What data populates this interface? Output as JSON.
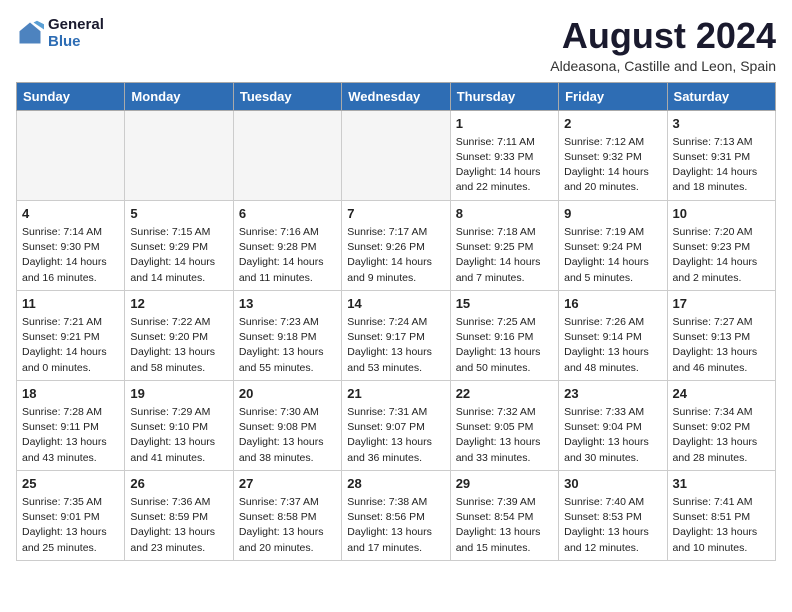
{
  "header": {
    "logo_line1": "General",
    "logo_line2": "Blue",
    "month_year": "August 2024",
    "location": "Aldeasona, Castille and Leon, Spain"
  },
  "days_of_week": [
    "Sunday",
    "Monday",
    "Tuesday",
    "Wednesday",
    "Thursday",
    "Friday",
    "Saturday"
  ],
  "weeks": [
    [
      {
        "day": "",
        "info": ""
      },
      {
        "day": "",
        "info": ""
      },
      {
        "day": "",
        "info": ""
      },
      {
        "day": "",
        "info": ""
      },
      {
        "day": "1",
        "info": "Sunrise: 7:11 AM\nSunset: 9:33 PM\nDaylight: 14 hours\nand 22 minutes."
      },
      {
        "day": "2",
        "info": "Sunrise: 7:12 AM\nSunset: 9:32 PM\nDaylight: 14 hours\nand 20 minutes."
      },
      {
        "day": "3",
        "info": "Sunrise: 7:13 AM\nSunset: 9:31 PM\nDaylight: 14 hours\nand 18 minutes."
      }
    ],
    [
      {
        "day": "4",
        "info": "Sunrise: 7:14 AM\nSunset: 9:30 PM\nDaylight: 14 hours\nand 16 minutes."
      },
      {
        "day": "5",
        "info": "Sunrise: 7:15 AM\nSunset: 9:29 PM\nDaylight: 14 hours\nand 14 minutes."
      },
      {
        "day": "6",
        "info": "Sunrise: 7:16 AM\nSunset: 9:28 PM\nDaylight: 14 hours\nand 11 minutes."
      },
      {
        "day": "7",
        "info": "Sunrise: 7:17 AM\nSunset: 9:26 PM\nDaylight: 14 hours\nand 9 minutes."
      },
      {
        "day": "8",
        "info": "Sunrise: 7:18 AM\nSunset: 9:25 PM\nDaylight: 14 hours\nand 7 minutes."
      },
      {
        "day": "9",
        "info": "Sunrise: 7:19 AM\nSunset: 9:24 PM\nDaylight: 14 hours\nand 5 minutes."
      },
      {
        "day": "10",
        "info": "Sunrise: 7:20 AM\nSunset: 9:23 PM\nDaylight: 14 hours\nand 2 minutes."
      }
    ],
    [
      {
        "day": "11",
        "info": "Sunrise: 7:21 AM\nSunset: 9:21 PM\nDaylight: 14 hours\nand 0 minutes."
      },
      {
        "day": "12",
        "info": "Sunrise: 7:22 AM\nSunset: 9:20 PM\nDaylight: 13 hours\nand 58 minutes."
      },
      {
        "day": "13",
        "info": "Sunrise: 7:23 AM\nSunset: 9:18 PM\nDaylight: 13 hours\nand 55 minutes."
      },
      {
        "day": "14",
        "info": "Sunrise: 7:24 AM\nSunset: 9:17 PM\nDaylight: 13 hours\nand 53 minutes."
      },
      {
        "day": "15",
        "info": "Sunrise: 7:25 AM\nSunset: 9:16 PM\nDaylight: 13 hours\nand 50 minutes."
      },
      {
        "day": "16",
        "info": "Sunrise: 7:26 AM\nSunset: 9:14 PM\nDaylight: 13 hours\nand 48 minutes."
      },
      {
        "day": "17",
        "info": "Sunrise: 7:27 AM\nSunset: 9:13 PM\nDaylight: 13 hours\nand 46 minutes."
      }
    ],
    [
      {
        "day": "18",
        "info": "Sunrise: 7:28 AM\nSunset: 9:11 PM\nDaylight: 13 hours\nand 43 minutes."
      },
      {
        "day": "19",
        "info": "Sunrise: 7:29 AM\nSunset: 9:10 PM\nDaylight: 13 hours\nand 41 minutes."
      },
      {
        "day": "20",
        "info": "Sunrise: 7:30 AM\nSunset: 9:08 PM\nDaylight: 13 hours\nand 38 minutes."
      },
      {
        "day": "21",
        "info": "Sunrise: 7:31 AM\nSunset: 9:07 PM\nDaylight: 13 hours\nand 36 minutes."
      },
      {
        "day": "22",
        "info": "Sunrise: 7:32 AM\nSunset: 9:05 PM\nDaylight: 13 hours\nand 33 minutes."
      },
      {
        "day": "23",
        "info": "Sunrise: 7:33 AM\nSunset: 9:04 PM\nDaylight: 13 hours\nand 30 minutes."
      },
      {
        "day": "24",
        "info": "Sunrise: 7:34 AM\nSunset: 9:02 PM\nDaylight: 13 hours\nand 28 minutes."
      }
    ],
    [
      {
        "day": "25",
        "info": "Sunrise: 7:35 AM\nSunset: 9:01 PM\nDaylight: 13 hours\nand 25 minutes."
      },
      {
        "day": "26",
        "info": "Sunrise: 7:36 AM\nSunset: 8:59 PM\nDaylight: 13 hours\nand 23 minutes."
      },
      {
        "day": "27",
        "info": "Sunrise: 7:37 AM\nSunset: 8:58 PM\nDaylight: 13 hours\nand 20 minutes."
      },
      {
        "day": "28",
        "info": "Sunrise: 7:38 AM\nSunset: 8:56 PM\nDaylight: 13 hours\nand 17 minutes."
      },
      {
        "day": "29",
        "info": "Sunrise: 7:39 AM\nSunset: 8:54 PM\nDaylight: 13 hours\nand 15 minutes."
      },
      {
        "day": "30",
        "info": "Sunrise: 7:40 AM\nSunset: 8:53 PM\nDaylight: 13 hours\nand 12 minutes."
      },
      {
        "day": "31",
        "info": "Sunrise: 7:41 AM\nSunset: 8:51 PM\nDaylight: 13 hours\nand 10 minutes."
      }
    ]
  ]
}
